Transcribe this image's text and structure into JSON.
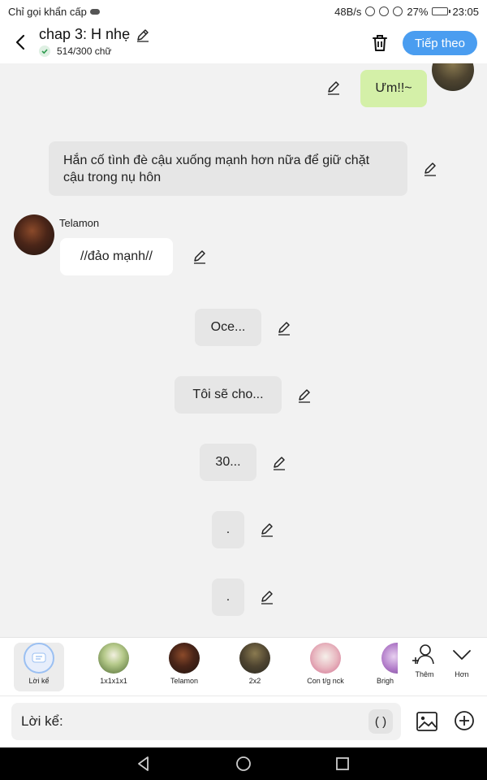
{
  "status_bar": {
    "carrier": "Chỉ gọi khẩn cấp",
    "speed": "48B/s",
    "battery": "27%",
    "time": "23:05"
  },
  "header": {
    "title": "chap 3: H nhẹ",
    "word_count": "514/300 chữ",
    "next_label": "Tiếp theo"
  },
  "messages": [
    {
      "type": "right",
      "text": "Ưm!!~",
      "color": "#d4f0a8"
    },
    {
      "type": "narration",
      "text": "Hắn cố tình đè cậu xuống mạnh hơn nữa để giữ chặt cậu trong nụ hôn"
    },
    {
      "type": "left",
      "speaker": "Telamon",
      "text": "//đảo mạnh//"
    },
    {
      "type": "narration",
      "text": "Oce..."
    },
    {
      "type": "narration",
      "text": "Tôi sẽ cho..."
    },
    {
      "type": "narration",
      "text": "30..."
    },
    {
      "type": "narration",
      "text": "."
    },
    {
      "type": "narration",
      "text": "."
    }
  ],
  "characters": [
    {
      "label": "Lời kể",
      "icon": "narration-icon",
      "selected": true
    },
    {
      "label": "1x1x1x1",
      "icon": "avatar-green"
    },
    {
      "label": "Telamon",
      "icon": "avatar-telamon"
    },
    {
      "label": "2x2",
      "icon": "avatar-2x2"
    },
    {
      "label": "Con t/g nck",
      "icon": "avatar-cat"
    },
    {
      "label": "Brigh",
      "icon": "avatar-bright"
    }
  ],
  "char_actions": {
    "add_label": "Thêm",
    "more_label": "Hơn"
  },
  "input": {
    "placeholder": "Lời kể:",
    "paren_label": "( )"
  },
  "colors": {
    "accent": "#4a9df0",
    "narration_bg": "#e6e6e6",
    "user_bubble": "#d4f0a8"
  }
}
